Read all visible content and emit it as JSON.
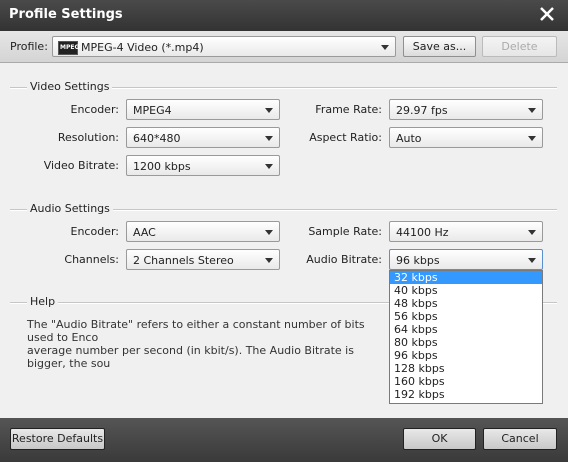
{
  "window": {
    "title": "Profile Settings"
  },
  "profile": {
    "label": "Profile:",
    "value": "MPEG-4 Video (*.mp4)",
    "icon_text": "MPEG",
    "save_as_label": "Save as...",
    "delete_label": "Delete"
  },
  "video": {
    "section_title": "Video Settings",
    "encoder_label": "Encoder:",
    "encoder_value": "MPEG4",
    "resolution_label": "Resolution:",
    "resolution_value": "640*480",
    "bitrate_label": "Video Bitrate:",
    "bitrate_value": "1200 kbps",
    "framerate_label": "Frame Rate:",
    "framerate_value": "29.97 fps",
    "aspect_label": "Aspect Ratio:",
    "aspect_value": "Auto"
  },
  "audio": {
    "section_title": "Audio Settings",
    "encoder_label": "Encoder:",
    "encoder_value": "AAC",
    "channels_label": "Channels:",
    "channels_value": "2 Channels Stereo",
    "samplerate_label": "Sample Rate:",
    "samplerate_value": "44100 Hz",
    "bitrate_label": "Audio Bitrate:",
    "bitrate_value": "96 kbps"
  },
  "bitrate_options": [
    "32 kbps",
    "40 kbps",
    "48 kbps",
    "56 kbps",
    "64 kbps",
    "80 kbps",
    "96 kbps",
    "128 kbps",
    "160 kbps",
    "192 kbps"
  ],
  "bitrate_highlighted_index": 0,
  "help": {
    "section_title": "Help",
    "line1": "The \"Audio Bitrate\" refers to either a constant number of bits used to Enco",
    "line2": "average number per second (in kbit/s). The Audio Bitrate is bigger, the sou"
  },
  "footer": {
    "restore_label": "Restore Defaults",
    "ok_label": "OK",
    "cancel_label": "Cancel"
  },
  "colors": {
    "titlebar": "#3a3a3a",
    "highlight": "#3399ff",
    "footer": "#444444"
  }
}
